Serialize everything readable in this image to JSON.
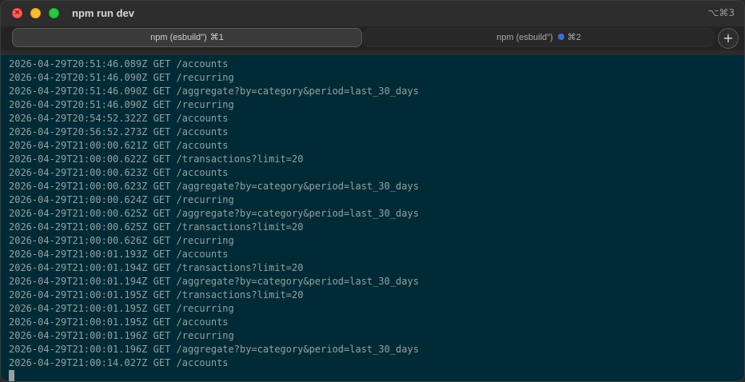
{
  "window": {
    "title": "npm run dev",
    "shortcut": "⌥⌘3"
  },
  "tabs": [
    {
      "label": "npm (esbuild\")",
      "key": "⌘1",
      "active": true
    },
    {
      "label": "npm (esbuild\")",
      "key": "⌘2",
      "active": false,
      "indicator_color": "#3b6fe0"
    }
  ],
  "new_tab_label": "+",
  "terminal": {
    "background": "#002b36",
    "foreground": "#93a1a1",
    "lines": [
      "2026-04-29T20:51:46.089Z GET /accounts",
      "2026-04-29T20:51:46.090Z GET /recurring",
      "2026-04-29T20:51:46.090Z GET /aggregate?by=category&period=last_30_days",
      "2026-04-29T20:51:46.090Z GET /recurring",
      "2026-04-29T20:54:52.322Z GET /accounts",
      "2026-04-29T20:56:52.273Z GET /accounts",
      "2026-04-29T21:00:00.621Z GET /accounts",
      "2026-04-29T21:00:00.622Z GET /transactions?limit=20",
      "2026-04-29T21:00:00.623Z GET /accounts",
      "2026-04-29T21:00:00.623Z GET /aggregate?by=category&period=last_30_days",
      "2026-04-29T21:00:00.624Z GET /recurring",
      "2026-04-29T21:00:00.625Z GET /aggregate?by=category&period=last_30_days",
      "2026-04-29T21:00:00.625Z GET /transactions?limit=20",
      "2026-04-29T21:00:00.626Z GET /recurring",
      "2026-04-29T21:00:01.193Z GET /accounts",
      "2026-04-29T21:00:01.194Z GET /transactions?limit=20",
      "2026-04-29T21:00:01.194Z GET /aggregate?by=category&period=last_30_days",
      "2026-04-29T21:00:01.195Z GET /transactions?limit=20",
      "2026-04-29T21:00:01.195Z GET /recurring",
      "2026-04-29T21:00:01.195Z GET /accounts",
      "2026-04-29T21:00:01.196Z GET /recurring",
      "2026-04-29T21:00:01.196Z GET /aggregate?by=category&period=last_30_days",
      "2026-04-29T21:00:14.027Z GET /accounts"
    ]
  }
}
